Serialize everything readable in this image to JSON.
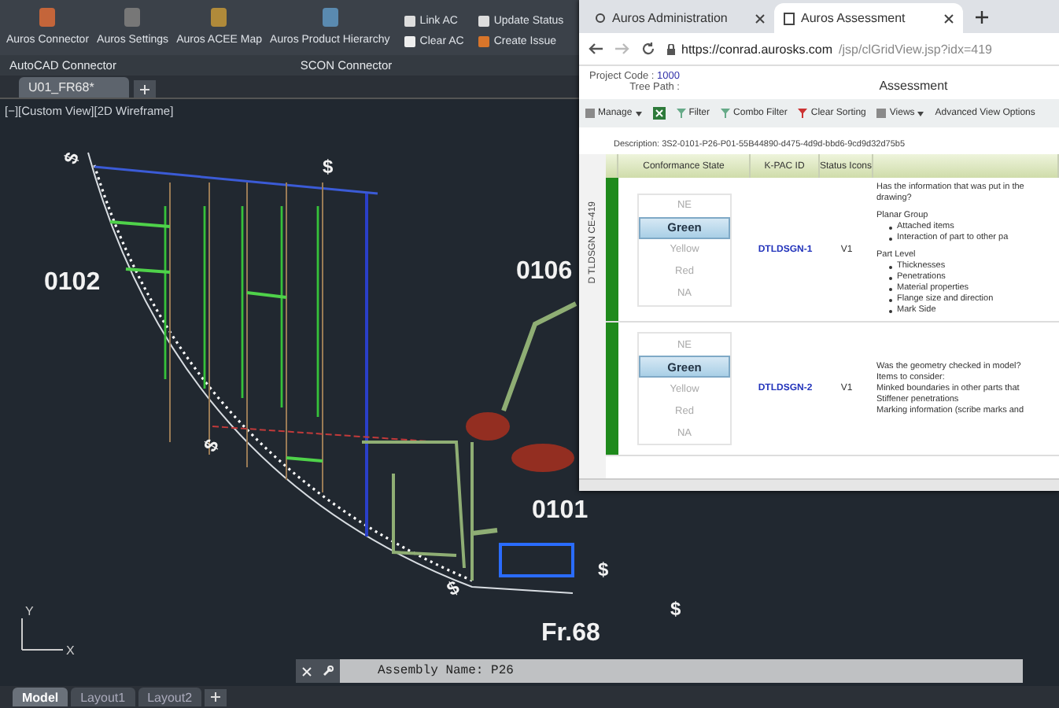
{
  "ribbon": {
    "large_buttons": [
      {
        "label": "Auros Connector"
      },
      {
        "label": "Auros Settings"
      },
      {
        "label": "Auros ACEE Map"
      },
      {
        "label": "Auros Product Hierarchy"
      }
    ],
    "small_buttons": [
      {
        "label": "Link AC"
      },
      {
        "label": "Clear AC"
      },
      {
        "label": "Update Status"
      },
      {
        "label": "Create Issue"
      }
    ],
    "panels": [
      "AutoCAD Connector",
      "SCON Connector"
    ]
  },
  "file_tabs": [
    {
      "label": "U01_FR68*",
      "selected": true
    }
  ],
  "viewport": {
    "label": "[−][Custom View][2D Wireframe]",
    "drawing_labels": [
      "0102",
      "0106",
      "0101",
      "Fr.68"
    ],
    "section_marks": [
      "$",
      "$",
      "$",
      "$",
      "$",
      "$"
    ],
    "ucs": {
      "x": "X",
      "y": "Y"
    }
  },
  "command_line": {
    "value": "Assembly Name: P26"
  },
  "layout_tabs": [
    {
      "label": "Model",
      "selected": true
    },
    {
      "label": "Layout1",
      "selected": false
    },
    {
      "label": "Layout2",
      "selected": false
    }
  ],
  "browser": {
    "tabs": [
      {
        "title": "Auros Administration",
        "selected": false
      },
      {
        "title": "Auros Assessment",
        "selected": true
      }
    ],
    "url_host": "https://conrad.aurosks.com",
    "url_path": "/jsp/clGridView.jsp?idx=419",
    "project_code_label": "Project Code :",
    "project_code": "1000",
    "tree_path_label": "Tree Path :",
    "page_title": "Assessment",
    "toolbar": [
      {
        "kind": "menu",
        "label": "Manage"
      },
      {
        "kind": "icon"
      },
      {
        "kind": "button",
        "label": "Filter"
      },
      {
        "kind": "button",
        "label": "Combo Filter"
      },
      {
        "kind": "button",
        "label": "Clear Sorting"
      },
      {
        "kind": "menu",
        "label": "Views"
      },
      {
        "kind": "link",
        "label": "Advanced View Options"
      }
    ],
    "description": "Description: 3S2-0101-P26-P01-55B44890-d475-4d9d-bbd6-9cd9d32d75b5",
    "group_label": "D TLDSGN CE-419",
    "columns": [
      "Conformance State",
      "K-PAC ID",
      "Status Icons"
    ],
    "rows": [
      {
        "states": [
          {
            "label": "NE",
            "selected": false
          },
          {
            "label": "Green",
            "selected": true
          },
          {
            "label": "Yellow",
            "selected": false
          },
          {
            "label": "Red",
            "selected": false
          },
          {
            "label": "NA",
            "selected": false
          }
        ],
        "kpac_id": "DTLDSGN-1",
        "status": "V1",
        "lines": [
          {
            "kind": "text",
            "text": "Has the information that was put in the drawing?"
          },
          {
            "kind": "text",
            "text": "Planar Group"
          },
          {
            "kind": "bullet",
            "text": "Attached items"
          },
          {
            "kind": "bullet",
            "text": "Interaction of part to other pa"
          },
          {
            "kind": "text",
            "text": "Part Level"
          },
          {
            "kind": "bullet",
            "text": "Thicknesses"
          },
          {
            "kind": "bullet",
            "text": "Penetrations"
          },
          {
            "kind": "bullet",
            "text": "Material properties"
          },
          {
            "kind": "bullet",
            "text": "Flange size and direction"
          },
          {
            "kind": "bullet",
            "text": "Mark Side"
          }
        ]
      },
      {
        "states": [
          {
            "label": "NE",
            "selected": false
          },
          {
            "label": "Green",
            "selected": true
          },
          {
            "label": "Yellow",
            "selected": false
          },
          {
            "label": "Red",
            "selected": false
          },
          {
            "label": "NA",
            "selected": false
          }
        ],
        "kpac_id": "DTLDSGN-2",
        "status": "V1",
        "lines": [
          {
            "kind": "line",
            "text": "Was the geometry checked in model?"
          },
          {
            "kind": "line",
            "text": "Items to consider:"
          },
          {
            "kind": "line",
            "text": "Minked boundaries in other parts that"
          },
          {
            "kind": "line",
            "text": "Stiffener penetrations"
          },
          {
            "kind": "line",
            "text": "Marking information (scribe marks and"
          }
        ]
      }
    ]
  }
}
